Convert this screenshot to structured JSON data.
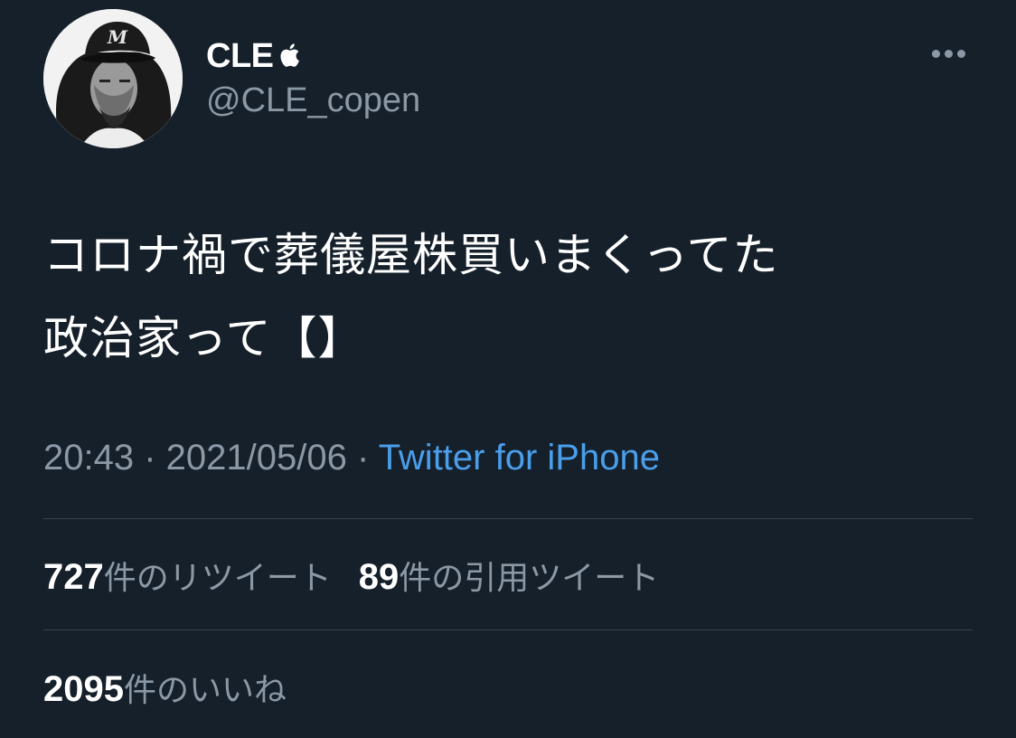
{
  "user": {
    "display_name": "CLE",
    "badge_icon": "apple-icon",
    "handle": "@CLE_copen",
    "avatar": "profile-avatar-image"
  },
  "menu": {
    "icon": "more-icon"
  },
  "tweet": {
    "text_line1": "コロナ禍で葬儀屋株買いまくってた",
    "text_line2": "政治家って【】"
  },
  "meta": {
    "time": "20:43",
    "separator1": " · ",
    "date": "2021/05/06",
    "separator2": " · ",
    "source": "Twitter for iPhone"
  },
  "stats": {
    "retweets_count": "727",
    "retweets_label": "件のリツイート",
    "quotes_count": "89",
    "quotes_label": "件の引用ツイート",
    "likes_count": "2095",
    "likes_label": "件のいいね"
  },
  "colors": {
    "background": "#15202b",
    "text_primary": "#ffffff",
    "text_secondary": "#8b98a5",
    "link": "#4a9eea",
    "divider": "#38444d"
  }
}
